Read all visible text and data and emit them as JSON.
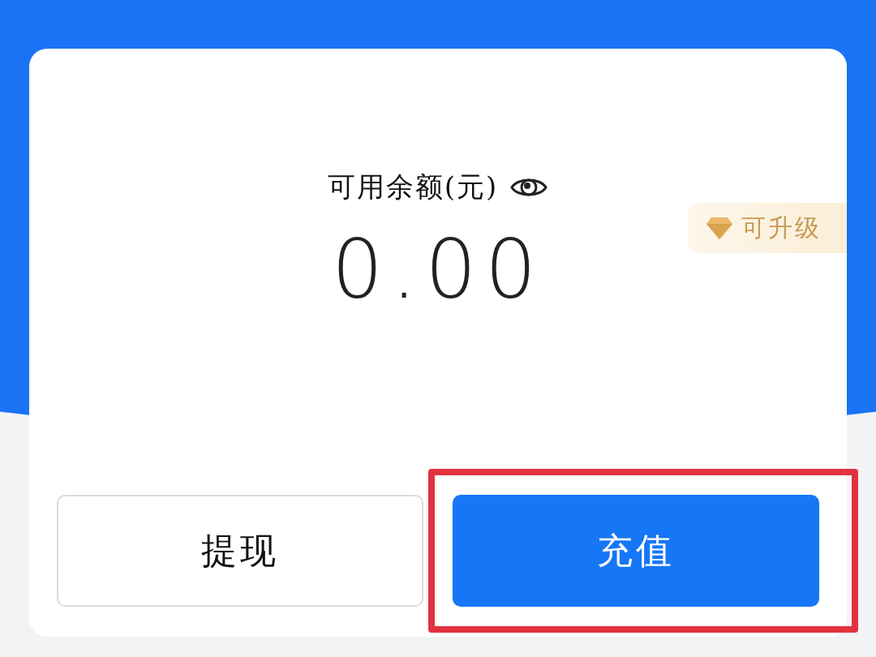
{
  "balance": {
    "label": "可用余额(元)",
    "amount": "0.00"
  },
  "badge": {
    "label": "可升级"
  },
  "buttons": [
    {
      "label": "提现",
      "kind": "secondary",
      "highlighted": false
    },
    {
      "label": "充值",
      "kind": "primary",
      "highlighted": true
    }
  ]
}
